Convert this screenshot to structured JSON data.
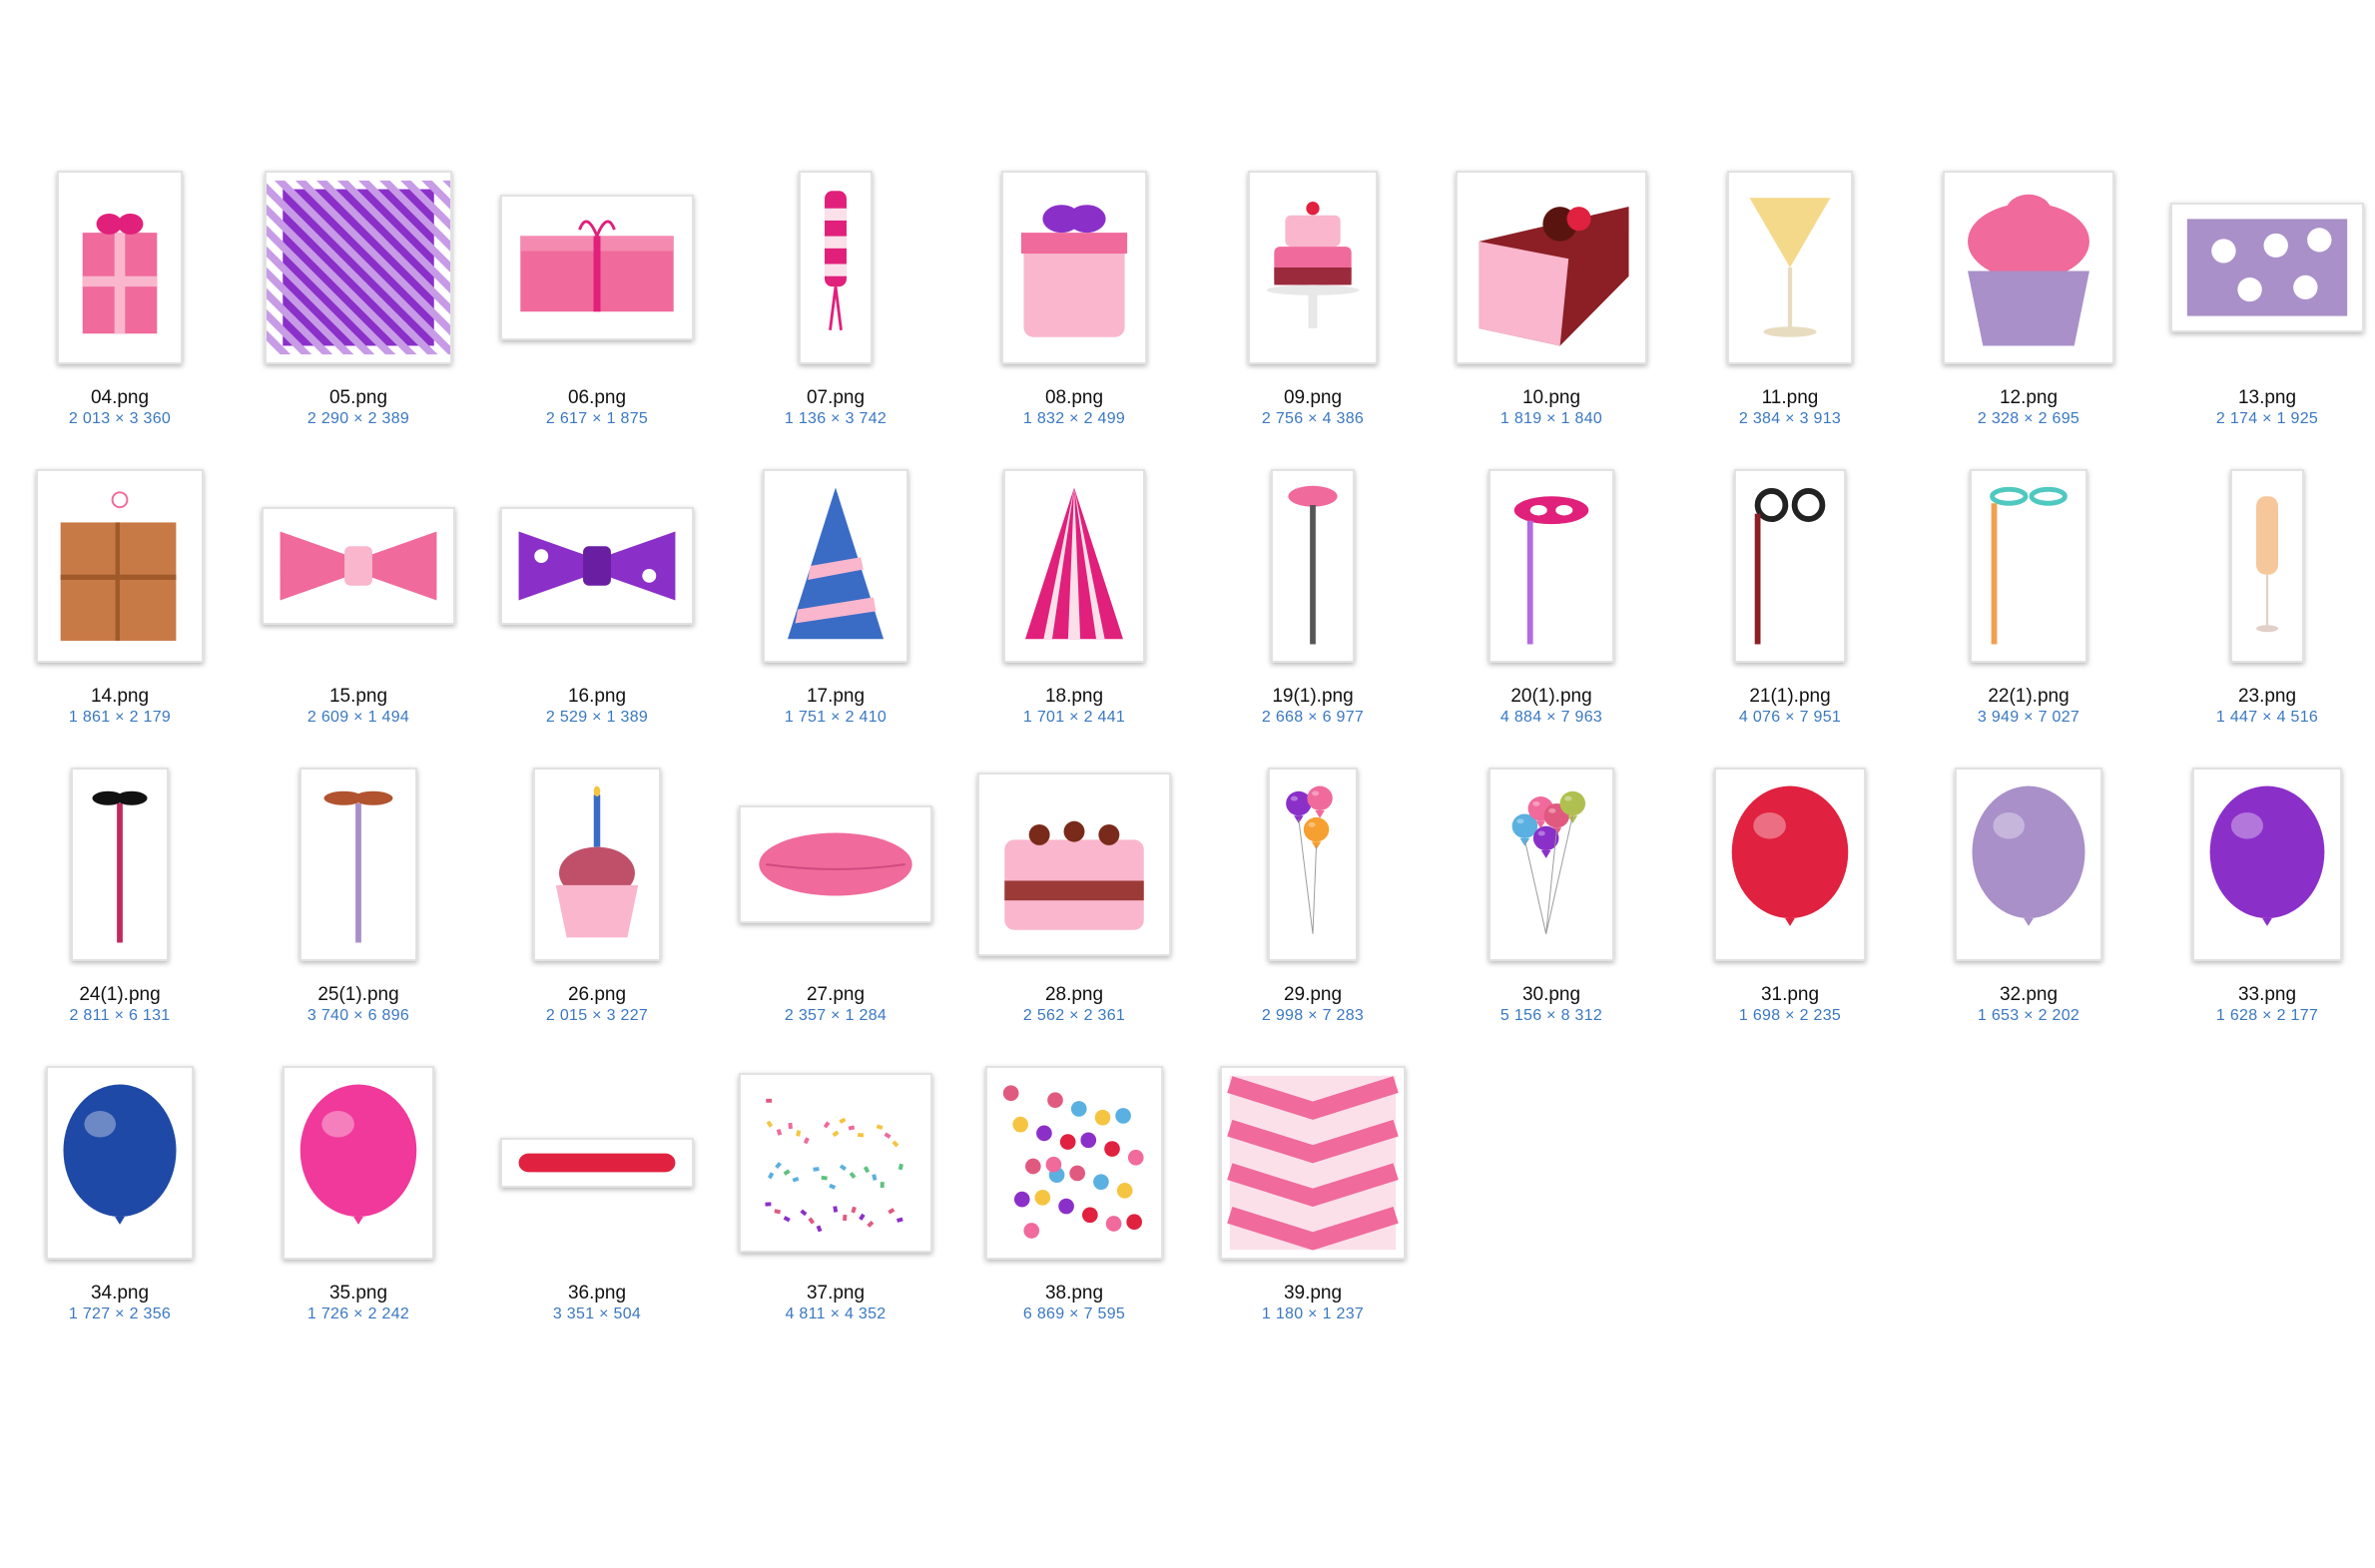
{
  "files": [
    {
      "name": "04.png",
      "dims": "2 013 × 3 360",
      "icon": "pink-gift-box-icon"
    },
    {
      "name": "05.png",
      "dims": "2 290 × 2 389",
      "icon": "purple-striped-box-icon"
    },
    {
      "name": "06.png",
      "dims": "2 617 × 1 875",
      "icon": "pink-present-icon"
    },
    {
      "name": "07.png",
      "dims": "1 136 × 3 742",
      "icon": "candy-stick-icon"
    },
    {
      "name": "08.png",
      "dims": "1 832 × 2 499",
      "icon": "round-gift-box-icon"
    },
    {
      "name": "09.png",
      "dims": "2 756 × 4 386",
      "icon": "cake-stand-icon"
    },
    {
      "name": "10.png",
      "dims": "1 819 × 1 840",
      "icon": "cake-slice-icon"
    },
    {
      "name": "11.png",
      "dims": "2 384 × 3 913",
      "icon": "cocktail-glass-icon"
    },
    {
      "name": "12.png",
      "dims": "2 328 × 2 695",
      "icon": "pink-cupcake-icon"
    },
    {
      "name": "13.png",
      "dims": "2 174 × 1 925",
      "icon": "polka-dot-box-icon"
    },
    {
      "name": "14.png",
      "dims": "1 861 × 2 179",
      "icon": "kraft-box-icon"
    },
    {
      "name": "15.png",
      "dims": "2 609 × 1 494",
      "icon": "striped-bow-tie-icon"
    },
    {
      "name": "16.png",
      "dims": "2 529 × 1 389",
      "icon": "dotted-bow-tie-icon"
    },
    {
      "name": "17.png",
      "dims": "1 751 × 2 410",
      "icon": "blue-party-hat-icon"
    },
    {
      "name": "18.png",
      "dims": "1 701 × 2 441",
      "icon": "pink-party-hat-icon"
    },
    {
      "name": "19(1).png",
      "dims": "2 668 × 6 977",
      "icon": "lips-on-stick-icon"
    },
    {
      "name": "20(1).png",
      "dims": "4 884 × 7 963",
      "icon": "mask-on-stick-icon"
    },
    {
      "name": "21(1).png",
      "dims": "4 076 × 7 951",
      "icon": "glasses-on-stick-icon"
    },
    {
      "name": "22(1).png",
      "dims": "3 949 × 7 027",
      "icon": "cat-eye-glasses-icon"
    },
    {
      "name": "23.png",
      "dims": "1 447 × 4 516",
      "icon": "champagne-glass-icon"
    },
    {
      "name": "24(1).png",
      "dims": "2 811 × 6 131",
      "icon": "black-mustache-icon"
    },
    {
      "name": "25(1).png",
      "dims": "3 740 × 6 896",
      "icon": "brown-mustache-icon"
    },
    {
      "name": "26.png",
      "dims": "2 015 × 3 227",
      "icon": "candle-cupcake-icon"
    },
    {
      "name": "27.png",
      "dims": "2 357 × 1 284",
      "icon": "pink-lips-icon"
    },
    {
      "name": "28.png",
      "dims": "2 562 × 2 361",
      "icon": "birthday-cake-icon"
    },
    {
      "name": "29.png",
      "dims": "2 998 × 7 283",
      "icon": "balloon-trio-icon"
    },
    {
      "name": "30.png",
      "dims": "5 156 × 8 312",
      "icon": "balloon-bunch-icon"
    },
    {
      "name": "31.png",
      "dims": "1 698 × 2 235",
      "icon": "red-balloon-icon"
    },
    {
      "name": "32.png",
      "dims": "1 653 × 2 202",
      "icon": "lavender-balloon-icon"
    },
    {
      "name": "33.png",
      "dims": "1 628 × 2 177",
      "icon": "purple-balloon-icon"
    },
    {
      "name": "34.png",
      "dims": "1 727 × 2 356",
      "icon": "blue-balloon-icon"
    },
    {
      "name": "35.png",
      "dims": "1 726 × 2 242",
      "icon": "pink-balloon-icon"
    },
    {
      "name": "36.png",
      "dims": "3 351 × 504",
      "icon": "pink-brush-stroke-icon"
    },
    {
      "name": "37.png",
      "dims": "4 811 × 4 352",
      "icon": "confetti-icon"
    },
    {
      "name": "38.png",
      "dims": "6 869 × 7 595",
      "icon": "dot-confetti-icon"
    },
    {
      "name": "39.png",
      "dims": "1 180 × 1 237",
      "icon": "chevron-pattern-icon"
    }
  ],
  "colors": {
    "label_text": "#111111",
    "dims_text": "#3a78c2",
    "frame_border": "#e2e2e2",
    "pink": "#f06a9b",
    "light_pink": "#f9b6cc",
    "magenta": "#e0207a",
    "purple": "#8b2fc9",
    "lavender": "#a990c9",
    "red": "#e0213f",
    "blue": "#1e49a6",
    "brown": "#c87a46",
    "yellow": "#f5d98a"
  }
}
